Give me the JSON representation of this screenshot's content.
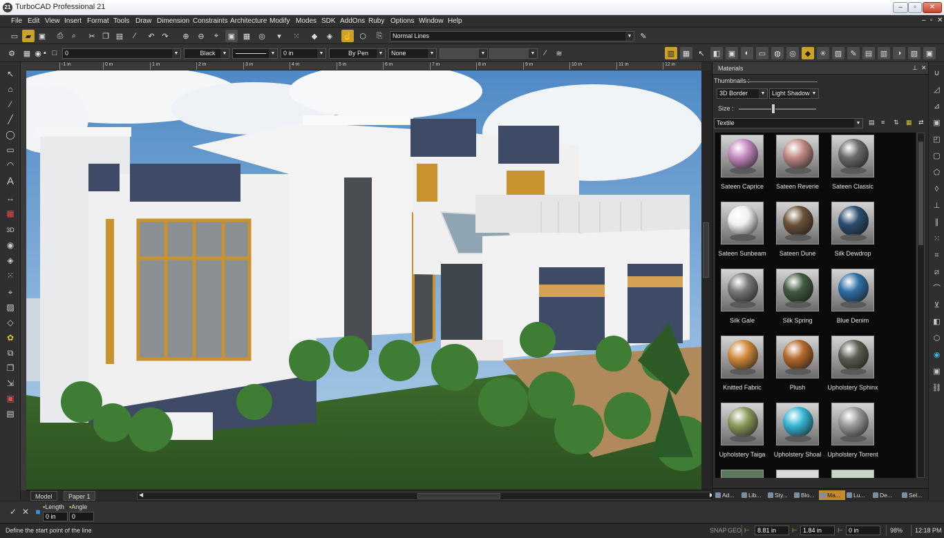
{
  "title_bar": {
    "app_icon_text": "21",
    "title": "TurboCAD Professional 21"
  },
  "menu": [
    "File",
    "Edit",
    "View",
    "Insert",
    "Format",
    "Tools",
    "Draw",
    "Dimension",
    "Constraints",
    "Architecture",
    "Modify",
    "Modes",
    "SDK",
    "AddOns",
    "Ruby",
    "Options",
    "Window",
    "Help"
  ],
  "toolbar1": {
    "line_style": "Normal Lines"
  },
  "toolbar2": {
    "layer": "0",
    "color": "Black",
    "width": "0 in",
    "pen": "By Pen",
    "fill": "None"
  },
  "ruler_labels": [
    "-1 in",
    "0 in",
    "1 in",
    "2 in",
    "3 in",
    "4 in",
    "5 in",
    "6 in",
    "7 in",
    "8 in",
    "9 in",
    "10 in",
    "11 in",
    "12 in"
  ],
  "tabs": {
    "model": "Model",
    "paper": "Paper 1"
  },
  "materials_panel": {
    "title": "Materials",
    "thumbnails_label": "Thumbnails :",
    "border_style": "3D Border",
    "shadow_style": "Light Shadow",
    "size_label": "Size :",
    "category": "Textile",
    "materials": [
      {
        "name": "Sateen Caprice",
        "color": "#c58ac0"
      },
      {
        "name": "Sateen Reverie",
        "color": "#c28a86"
      },
      {
        "name": "Sateen Classic",
        "color": "#6a6a6a"
      },
      {
        "name": "Sateen Sunbeam",
        "color": "#f0f0f0"
      },
      {
        "name": "Sateen Dune",
        "color": "#6b5138"
      },
      {
        "name": "Silk Dewdrop",
        "color": "#2a4d70"
      },
      {
        "name": "Silk Gale",
        "color": "#777777"
      },
      {
        "name": "Silk Spring",
        "color": "#3f5a3f"
      },
      {
        "name": "Blue Denim",
        "color": "#2f6fa6"
      },
      {
        "name": "Knitted Fabric",
        "color": "#d08a3a"
      },
      {
        "name": "Plush",
        "color": "#b4692a"
      },
      {
        "name": "Upholstery Sphinx",
        "color": "#5b5d52"
      },
      {
        "name": "Upholstery Taiga",
        "color": "#8c9a5c"
      },
      {
        "name": "Upholstery Shoal",
        "color": "#35b6d6"
      },
      {
        "name": "Upholstery Torrent",
        "color": "#9a9a9a"
      }
    ],
    "tabs": [
      "Ad...",
      "Lib...",
      "Sty...",
      "Blo...",
      "Ma...",
      "Lu...",
      "De...",
      "Sel..."
    ]
  },
  "command_bar": {
    "length_label": "Length",
    "length_value": "0 in",
    "angle_label": "Angle",
    "angle_value": "0"
  },
  "status_bar": {
    "prompt": "Define the start point of the line",
    "snap": "SNAP",
    "geo": "GEO",
    "x": "8.81 in",
    "y": "1.84 in",
    "z": "0 in",
    "zoom": "98%",
    "time": "12:18 PM"
  }
}
